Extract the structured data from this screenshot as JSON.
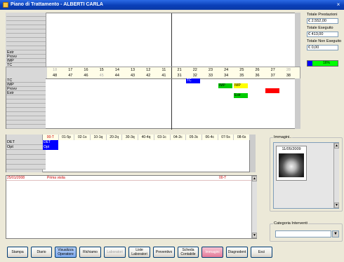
{
  "window": {
    "title": "Piano di Trattamento - ALBERTI CARLA",
    "close": "×"
  },
  "upper_grid": {
    "labels": [
      "",
      "",
      "",
      "",
      "",
      "",
      "",
      "",
      "",
      "Estr",
      "Provv",
      "IMP",
      "TC"
    ]
  },
  "teeth_upper": {
    "row1": [
      "18",
      "17",
      "16",
      "15",
      "14",
      "13",
      "12",
      "11",
      "21",
      "22",
      "23",
      "24",
      "25",
      "26",
      "27",
      "28"
    ],
    "row2": [
      "48",
      "47",
      "46",
      "45",
      "44",
      "43",
      "42",
      "41",
      "31",
      "32",
      "33",
      "34",
      "35",
      "36",
      "37",
      "38"
    ]
  },
  "lower_grid": {
    "labels": [
      "TC",
      "IMP",
      "Provv",
      "Estr",
      "",
      "",
      "",
      "",
      "",
      "",
      "",
      ""
    ],
    "cells": {
      "tc": "TC",
      "imp1": "IMP",
      "imp2": "IMP",
      "estr": "Estr"
    }
  },
  "totals": {
    "prest_label": "Totale Prestazioni",
    "prest_value": "€ 2.552,00",
    "eseg_label": "Totale Eseguito",
    "eseg_value": "€ 413,00",
    "noneseg_label": "Totale Non Eseguito",
    "noneseg_value": "€ 0,00",
    "progress_label": "16%",
    "progress_percent": 16
  },
  "sextant": {
    "headers": [
      "00-T",
      "01-5p",
      "02-1s",
      "10-1q",
      "20-2q",
      "30-3q",
      "40-4q",
      "03-1c",
      "04-2c",
      "05-3c",
      "06-4c",
      "07-5s",
      "08-6s"
    ],
    "labels": [
      "DET",
      "Opt",
      "",
      "",
      "",
      ""
    ],
    "cells": {
      "det": "DET",
      "opt": "Opt"
    }
  },
  "appointments": {
    "date": "25/01/2008",
    "desc": "Prima visita",
    "code": "00-T"
  },
  "images": {
    "label": "Immagini..",
    "date": "11/05/2009"
  },
  "categoria": {
    "label": "Categoria Interventi",
    "value": ""
  },
  "toolbar": [
    "Stampa",
    "Diario",
    "Visualizza Operatore",
    "Richiamo",
    "Laboratori",
    "Liste Laboratori",
    "Preventivo",
    "Scheda Contabile",
    "Immagini",
    "Diagnodent",
    "Esci"
  ],
  "colors": {
    "tc": "#0000ff",
    "imp": "#00cc00",
    "imp_yellow": "#ffff00",
    "estr": "#00cc00",
    "red": "#ff0000"
  }
}
